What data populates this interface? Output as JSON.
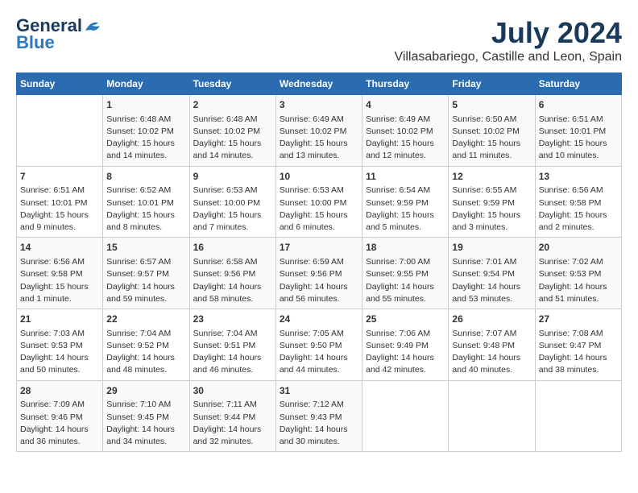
{
  "header": {
    "logo_line1": "General",
    "logo_line2": "Blue",
    "month": "July 2024",
    "location": "Villasabariego, Castille and Leon, Spain"
  },
  "weekdays": [
    "Sunday",
    "Monday",
    "Tuesday",
    "Wednesday",
    "Thursday",
    "Friday",
    "Saturday"
  ],
  "weeks": [
    [
      {
        "day": "",
        "info": ""
      },
      {
        "day": "1",
        "info": "Sunrise: 6:48 AM\nSunset: 10:02 PM\nDaylight: 15 hours\nand 14 minutes."
      },
      {
        "day": "2",
        "info": "Sunrise: 6:48 AM\nSunset: 10:02 PM\nDaylight: 15 hours\nand 14 minutes."
      },
      {
        "day": "3",
        "info": "Sunrise: 6:49 AM\nSunset: 10:02 PM\nDaylight: 15 hours\nand 13 minutes."
      },
      {
        "day": "4",
        "info": "Sunrise: 6:49 AM\nSunset: 10:02 PM\nDaylight: 15 hours\nand 12 minutes."
      },
      {
        "day": "5",
        "info": "Sunrise: 6:50 AM\nSunset: 10:02 PM\nDaylight: 15 hours\nand 11 minutes."
      },
      {
        "day": "6",
        "info": "Sunrise: 6:51 AM\nSunset: 10:01 PM\nDaylight: 15 hours\nand 10 minutes."
      }
    ],
    [
      {
        "day": "7",
        "info": "Sunrise: 6:51 AM\nSunset: 10:01 PM\nDaylight: 15 hours\nand 9 minutes."
      },
      {
        "day": "8",
        "info": "Sunrise: 6:52 AM\nSunset: 10:01 PM\nDaylight: 15 hours\nand 8 minutes."
      },
      {
        "day": "9",
        "info": "Sunrise: 6:53 AM\nSunset: 10:00 PM\nDaylight: 15 hours\nand 7 minutes."
      },
      {
        "day": "10",
        "info": "Sunrise: 6:53 AM\nSunset: 10:00 PM\nDaylight: 15 hours\nand 6 minutes."
      },
      {
        "day": "11",
        "info": "Sunrise: 6:54 AM\nSunset: 9:59 PM\nDaylight: 15 hours\nand 5 minutes."
      },
      {
        "day": "12",
        "info": "Sunrise: 6:55 AM\nSunset: 9:59 PM\nDaylight: 15 hours\nand 3 minutes."
      },
      {
        "day": "13",
        "info": "Sunrise: 6:56 AM\nSunset: 9:58 PM\nDaylight: 15 hours\nand 2 minutes."
      }
    ],
    [
      {
        "day": "14",
        "info": "Sunrise: 6:56 AM\nSunset: 9:58 PM\nDaylight: 15 hours\nand 1 minute."
      },
      {
        "day": "15",
        "info": "Sunrise: 6:57 AM\nSunset: 9:57 PM\nDaylight: 14 hours\nand 59 minutes."
      },
      {
        "day": "16",
        "info": "Sunrise: 6:58 AM\nSunset: 9:56 PM\nDaylight: 14 hours\nand 58 minutes."
      },
      {
        "day": "17",
        "info": "Sunrise: 6:59 AM\nSunset: 9:56 PM\nDaylight: 14 hours\nand 56 minutes."
      },
      {
        "day": "18",
        "info": "Sunrise: 7:00 AM\nSunset: 9:55 PM\nDaylight: 14 hours\nand 55 minutes."
      },
      {
        "day": "19",
        "info": "Sunrise: 7:01 AM\nSunset: 9:54 PM\nDaylight: 14 hours\nand 53 minutes."
      },
      {
        "day": "20",
        "info": "Sunrise: 7:02 AM\nSunset: 9:53 PM\nDaylight: 14 hours\nand 51 minutes."
      }
    ],
    [
      {
        "day": "21",
        "info": "Sunrise: 7:03 AM\nSunset: 9:53 PM\nDaylight: 14 hours\nand 50 minutes."
      },
      {
        "day": "22",
        "info": "Sunrise: 7:04 AM\nSunset: 9:52 PM\nDaylight: 14 hours\nand 48 minutes."
      },
      {
        "day": "23",
        "info": "Sunrise: 7:04 AM\nSunset: 9:51 PM\nDaylight: 14 hours\nand 46 minutes."
      },
      {
        "day": "24",
        "info": "Sunrise: 7:05 AM\nSunset: 9:50 PM\nDaylight: 14 hours\nand 44 minutes."
      },
      {
        "day": "25",
        "info": "Sunrise: 7:06 AM\nSunset: 9:49 PM\nDaylight: 14 hours\nand 42 minutes."
      },
      {
        "day": "26",
        "info": "Sunrise: 7:07 AM\nSunset: 9:48 PM\nDaylight: 14 hours\nand 40 minutes."
      },
      {
        "day": "27",
        "info": "Sunrise: 7:08 AM\nSunset: 9:47 PM\nDaylight: 14 hours\nand 38 minutes."
      }
    ],
    [
      {
        "day": "28",
        "info": "Sunrise: 7:09 AM\nSunset: 9:46 PM\nDaylight: 14 hours\nand 36 minutes."
      },
      {
        "day": "29",
        "info": "Sunrise: 7:10 AM\nSunset: 9:45 PM\nDaylight: 14 hours\nand 34 minutes."
      },
      {
        "day": "30",
        "info": "Sunrise: 7:11 AM\nSunset: 9:44 PM\nDaylight: 14 hours\nand 32 minutes."
      },
      {
        "day": "31",
        "info": "Sunrise: 7:12 AM\nSunset: 9:43 PM\nDaylight: 14 hours\nand 30 minutes."
      },
      {
        "day": "",
        "info": ""
      },
      {
        "day": "",
        "info": ""
      },
      {
        "day": "",
        "info": ""
      }
    ]
  ]
}
